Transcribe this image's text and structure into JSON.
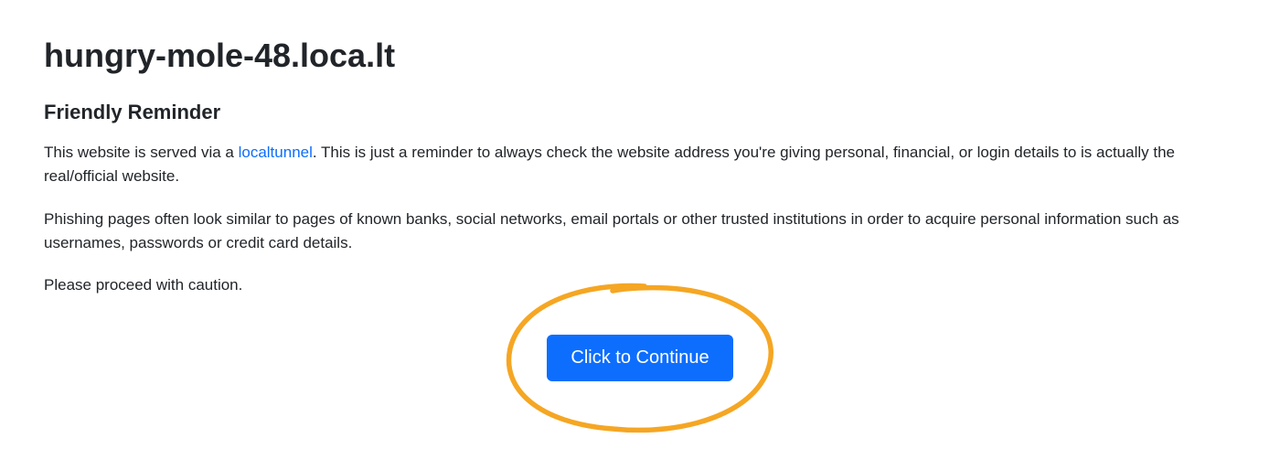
{
  "header": {
    "title": "hungry-mole-48.loca.lt",
    "subtitle": "Friendly Reminder"
  },
  "paragraphs": {
    "intro_pre": "This website is served via a ",
    "intro_link": "localtunnel",
    "intro_post": ". This is just a reminder to always check the website address you're giving personal, financial, or login details to is actually the real/official website.",
    "phishing": "Phishing pages often look similar to pages of known banks, social networks, email portals or other trusted institutions in order to acquire personal information such as usernames, passwords or credit card details.",
    "caution": "Please proceed with caution."
  },
  "button": {
    "label": "Click to Continue"
  },
  "colors": {
    "link": "#0d6efd",
    "button_bg": "#0d6efd",
    "annotation": "#f5a623"
  }
}
